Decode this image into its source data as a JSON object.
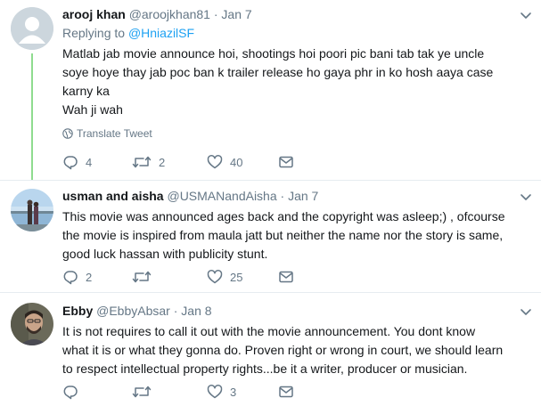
{
  "tweets": [
    {
      "name": "arooj khan",
      "handle": "@aroojkhan81",
      "separator": "·",
      "date": "Jan 7",
      "reply_prefix": "Replying to",
      "reply_to": "@HniazilSF",
      "lines": [
        "Matlab jab movie announce hoi, shootings hoi poori pic bani tab tak ye uncle",
        "soye hoye thay jab poc ban k trailer release ho gaya phr in ko hosh aaya case",
        "karny ka",
        "Wah ji wah"
      ],
      "translate_label": "Translate Tweet",
      "replies": "4",
      "retweets": "2",
      "likes": "40"
    },
    {
      "name": "usman and aisha",
      "handle": "@USMANandAisha",
      "separator": "·",
      "date": "Jan 7",
      "lines": [
        "This movie was announced ages back and the copyright was asleep;) , ofcourse",
        "the movie is inspired from maula jatt but neither the name nor the story is same,",
        "good luck hassan with publicity stunt."
      ],
      "replies": "2",
      "retweets": "",
      "likes": "25"
    },
    {
      "name": "Ebby",
      "handle": "@EbbyAbsar",
      "separator": "·",
      "date": "Jan 8",
      "lines": [
        "It is not requires to call it out with the movie announcement. You dont know",
        "what it is or what they gonna do. Proven right or wrong in court, we should learn",
        "to respect intellectual property rights...be it a writer, producer or musician."
      ],
      "replies": "",
      "retweets": "",
      "likes": "3"
    }
  ],
  "colors": {
    "thread_line": "#8fdc8f",
    "mention": "#1da1f2",
    "secondary_text": "#657786",
    "primary_text": "#14171a",
    "divider": "#e6ecf0"
  },
  "icons": [
    "chevron-down-icon",
    "globe-icon",
    "reply-icon",
    "retweet-icon",
    "like-icon",
    "direct-message-icon"
  ]
}
